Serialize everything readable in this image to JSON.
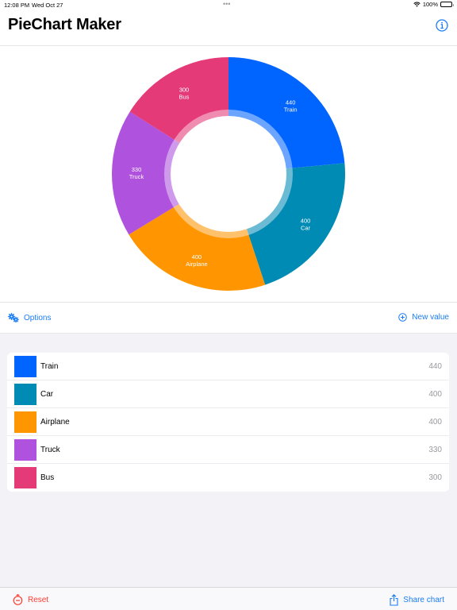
{
  "status_bar": {
    "time": "12:08 PM",
    "date": "Wed Oct 27",
    "multitask_dots": "•••",
    "battery_percent": "100%",
    "battery_level": 1.0
  },
  "header": {
    "title": "PieChart Maker",
    "info_icon": "info-circle-icon"
  },
  "actions": {
    "options_label": "Options",
    "options_icon": "gears-icon",
    "new_value_label": "New value",
    "new_value_icon": "plus-circle-icon"
  },
  "bottom_bar": {
    "reset_label": "Reset",
    "reset_icon": "reset-timer-icon",
    "share_label": "Share chart",
    "share_icon": "share-icon"
  },
  "colors": {
    "accent": "#1a7cf5",
    "destructive": "#ff3b30"
  },
  "list": [
    {
      "label": "Train",
      "value": "440",
      "color": "#0064ff"
    },
    {
      "label": "Car",
      "value": "400",
      "color": "#008bb5"
    },
    {
      "label": "Airplane",
      "value": "400",
      "color": "#ff9500"
    },
    {
      "label": "Truck",
      "value": "330",
      "color": "#af52de"
    },
    {
      "label": "Bus",
      "value": "300",
      "color": "#e53a78"
    }
  ],
  "chart_data": {
    "type": "pie",
    "variant": "donut",
    "title": "",
    "start": "top",
    "direction": "clockwise",
    "categories": [
      "Train",
      "Car",
      "Airplane",
      "Truck",
      "Bus"
    ],
    "values": [
      440,
      400,
      400,
      330,
      300
    ],
    "colors": [
      "#0064ff",
      "#008bb5",
      "#ff9500",
      "#af52de",
      "#e53a78"
    ],
    "data_labels": [
      "440\nTrain",
      "400\nCar",
      "400\nAirplane",
      "330\nTruck",
      "300\nBus"
    ]
  }
}
